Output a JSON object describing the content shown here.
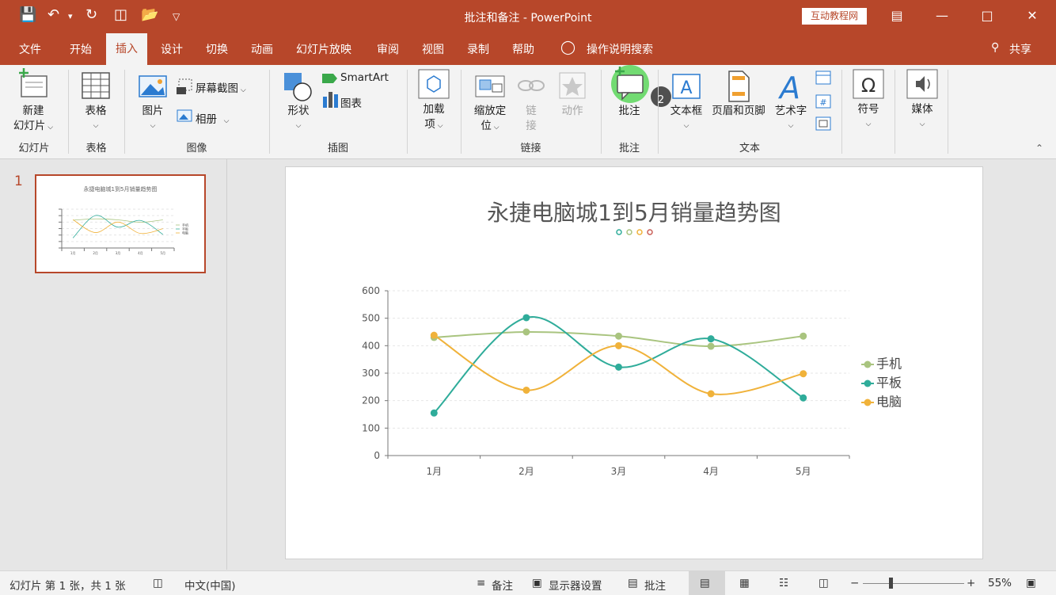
{
  "window": {
    "title": "批注和备注 - PowerPoint",
    "brand_badge": "互动教程网",
    "accent_color": "#b7472a",
    "qat_icons": [
      "save-icon",
      "undo-icon",
      "redo-icon",
      "present-icon",
      "open-icon",
      "customize-icon"
    ],
    "controls": [
      "restore-ribbon-icon",
      "minimize-icon",
      "maximize-icon",
      "close-icon"
    ]
  },
  "menu": {
    "tabs": [
      "文件",
      "开始",
      "插入",
      "设计",
      "切换",
      "动画",
      "幻灯片放映",
      "审阅",
      "视图",
      "录制",
      "帮助"
    ],
    "active_tab": "插入",
    "tell_me": "操作说明搜索",
    "share": "共享"
  },
  "ribbon": {
    "groups": [
      "幻灯片",
      "表格",
      "图像",
      "插图",
      "链接",
      "批注",
      "文本"
    ],
    "new_slide": [
      "新建",
      "幻灯片"
    ],
    "table": "表格",
    "picture": "图片",
    "screenshot": "屏幕截图",
    "album": "相册",
    "shapes": "形状",
    "smartart": "SmartArt",
    "chart": "图表",
    "addins": [
      "加载",
      "项"
    ],
    "zoom": [
      "缩放定",
      "位"
    ],
    "link": [
      "链",
      "接"
    ],
    "action": "动作",
    "comment": "批注",
    "comment_badge": "2",
    "textbox": "文本框",
    "header_footer": "页眉和页脚",
    "wordart": "艺术字",
    "symbol": "符号",
    "media": "媒体"
  },
  "thumbnails": {
    "slide_number": "1",
    "thumb_title": "永捷电脑城1到5月销量趋势图"
  },
  "chart_data": {
    "type": "line",
    "smooth": true,
    "title": "永捷电脑城1到5月销量趋势图",
    "categories": [
      "1月",
      "2月",
      "3月",
      "4月",
      "5月"
    ],
    "ylim": [
      0,
      600
    ],
    "yticks": [
      "0",
      "100",
      "200",
      "300",
      "400",
      "500",
      "600"
    ],
    "grid": true,
    "legend_position": "right",
    "series": [
      {
        "name": "手机",
        "color": "#a9c47f",
        "values": [
          430,
          450,
          435,
          398,
          435
        ]
      },
      {
        "name": "平板",
        "color": "#2fac9a",
        "values": [
          155,
          502,
          322,
          425,
          210
        ]
      },
      {
        "name": "电脑",
        "color": "#f0b23a",
        "values": [
          438,
          238,
          400,
          225,
          298
        ]
      }
    ],
    "title_marker_colors": [
      "#2fac9a",
      "#a9c47f",
      "#f0b23a",
      "#c95f57"
    ]
  },
  "status": {
    "slide_info": "幻灯片 第 1 张，共 1 张",
    "language": "中文(中国)",
    "notes": "备注",
    "display_settings": "显示器设置",
    "comments": "批注",
    "zoom_percent": 55
  }
}
